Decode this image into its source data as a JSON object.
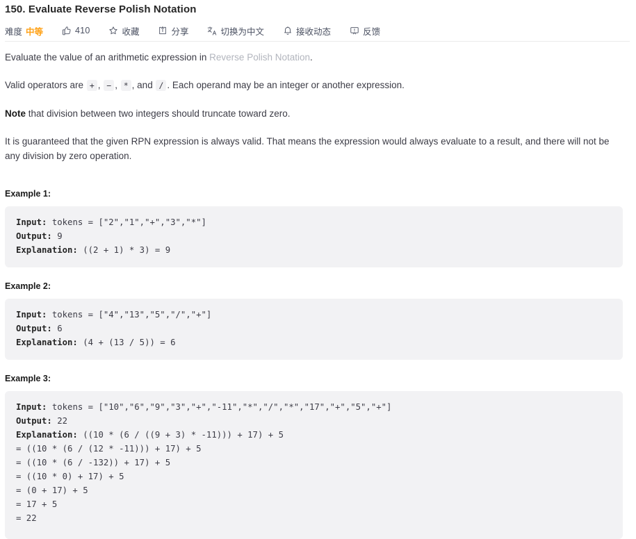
{
  "problem": {
    "title": "150. Evaluate Reverse Polish Notation"
  },
  "toolbar": {
    "difficulty_label": "难度",
    "difficulty_value": "中等",
    "difficulty_color": "#ffa116",
    "like_icon": "thumbs-up-icon",
    "like_count": "410",
    "favorite_icon": "star-icon",
    "favorite_label": "收藏",
    "share_icon": "share-icon",
    "share_label": "分享",
    "translate_icon": "translate-icon",
    "translate_label": "切换为中文",
    "notify_icon": "bell-icon",
    "notify_label": "接收动态",
    "feedback_icon": "speech-bubble-icon",
    "feedback_label": "反馈"
  },
  "description": {
    "p1_prefix": "Evaluate the value of an arithmetic expression in ",
    "p1_link": "Reverse Polish Notation",
    "p1_suffix": ".",
    "p2_prefix": "Valid operators are ",
    "p2_op1": "+",
    "p2_sep1": ", ",
    "p2_op2": "−",
    "p2_sep2": ", ",
    "p2_op3": "*",
    "p2_sep3": ", and ",
    "p2_op4": "/",
    "p2_suffix": ". Each operand may be an integer or another expression.",
    "p3_bold": "Note",
    "p3_rest": " that division between two integers should truncate toward zero.",
    "p4": "It is guaranteed that the given RPN expression is always valid. That means the expression would always evaluate to a result, and there will not be any division by zero operation."
  },
  "examples": [
    {
      "heading": "Example 1:",
      "input_label": "Input:",
      "input_value": " tokens = [\"2\",\"1\",\"+\",\"3\",\"*\"]",
      "output_label": "Output:",
      "output_value": " 9",
      "explanation_label": "Explanation:",
      "explanation_value": " ((2 + 1) * 3) = 9",
      "extra_lines": []
    },
    {
      "heading": "Example 2:",
      "input_label": "Input:",
      "input_value": " tokens = [\"4\",\"13\",\"5\",\"/\",\"+\"]",
      "output_label": "Output:",
      "output_value": " 6",
      "explanation_label": "Explanation:",
      "explanation_value": " (4 + (13 / 5)) = 6",
      "extra_lines": []
    },
    {
      "heading": "Example 3:",
      "input_label": "Input:",
      "input_value": " tokens = [\"10\",\"6\",\"9\",\"3\",\"+\",\"-11\",\"*\",\"/\",\"*\",\"17\",\"+\",\"5\",\"+\"]",
      "output_label": "Output:",
      "output_value": " 22",
      "explanation_label": "Explanation:",
      "explanation_value": " ((10 * (6 / ((9 + 3) * -11))) + 17) + 5",
      "extra_lines": [
        "= ((10 * (6 / (12 * -11))) + 17) + 5",
        "= ((10 * (6 / -132)) + 17) + 5",
        "= ((10 * 0) + 17) + 5",
        "= (0 + 17) + 5",
        "= 17 + 5",
        "= 22"
      ]
    }
  ]
}
